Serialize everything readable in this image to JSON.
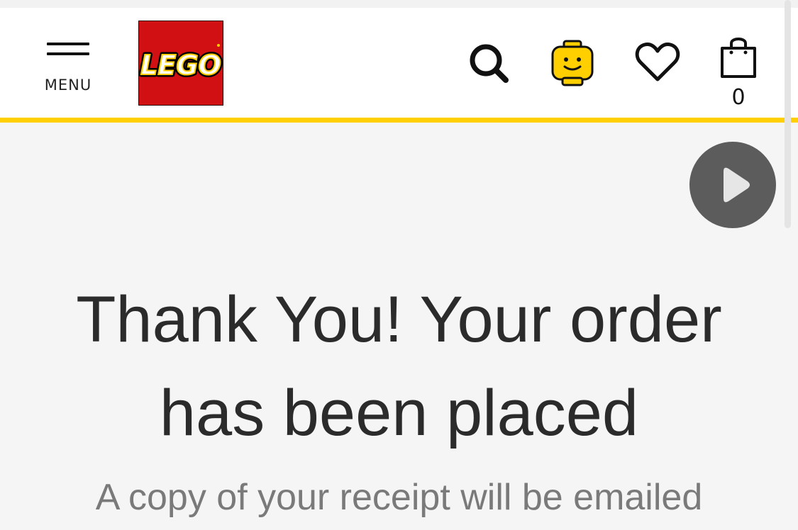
{
  "header": {
    "menu_label": "MENU",
    "logo_text": "LEGO",
    "bag_count": "0",
    "icons": [
      "menu-icon",
      "lego-logo",
      "search-icon",
      "account-minifig-icon",
      "heart-icon",
      "shopping-bag-icon"
    ]
  },
  "video": {
    "icon": "play-icon"
  },
  "main": {
    "title": "Thank You! Your order\nhas been placed",
    "subtitle": "A copy of your receipt will be emailed"
  },
  "colors": {
    "accent_yellow": "#ffcf00",
    "logo_red": "#d01012",
    "text_dark": "#2b2b2b",
    "text_muted": "#7a7a7a",
    "play_button": "#5c5c5c"
  }
}
